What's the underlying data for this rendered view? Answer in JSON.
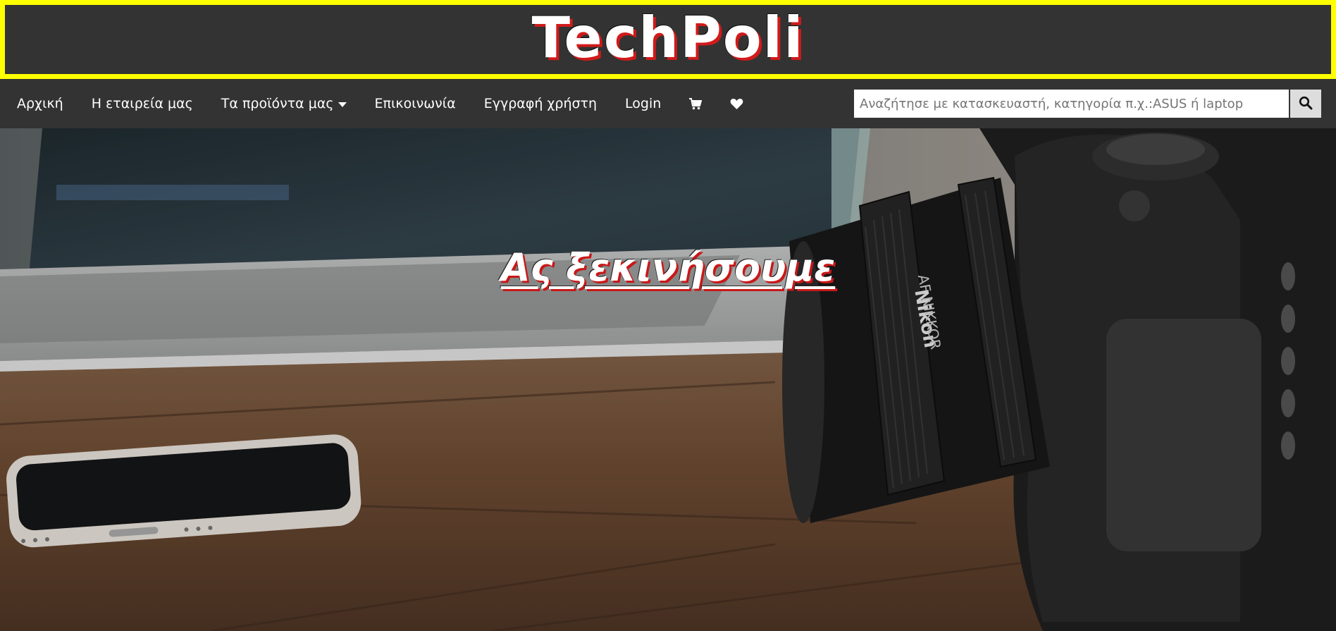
{
  "header": {
    "logo_text": "TechPoli",
    "border_color": "#ffff00",
    "background": "#333333"
  },
  "nav": {
    "items": [
      {
        "label": "Αρχική"
      },
      {
        "label": "Η εταιρεία μας"
      },
      {
        "label": "Τα προϊόντα μας",
        "has_dropdown": true
      },
      {
        "label": "Επικοινωνία"
      },
      {
        "label": "Εγγραφή χρήστη"
      },
      {
        "label": "Login"
      }
    ],
    "icons": [
      "cart-icon",
      "heart-icon",
      "search-icon"
    ]
  },
  "search": {
    "value": "",
    "placeholder": "Αναζήτησε με κατασκευαστή, κατηγορία π.χ.:ASUS ή laptop"
  },
  "hero": {
    "title": "Ας ξεκινήσουμε",
    "image": "laptop-phone-camera-on-wooden-table",
    "accent_color": "#c81818"
  }
}
